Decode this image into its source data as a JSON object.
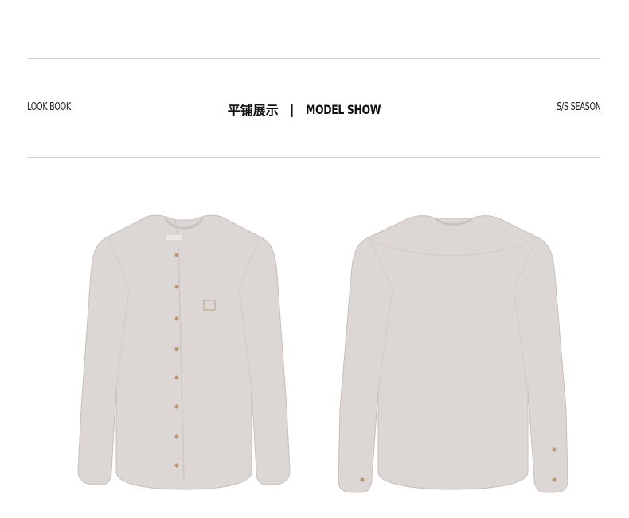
{
  "header": {
    "left_label": "LOOK BOOK",
    "title_cn": "平铺展示",
    "separator": "|",
    "title_en": "MODEL SHOW",
    "right_label": "S/S SEASON"
  },
  "products": [
    {
      "view": "front",
      "shirt_color": "#dcd6d4"
    },
    {
      "view": "back",
      "shirt_color": "#dcd6d4"
    }
  ],
  "colors": {
    "rule": "#cfcfcf",
    "shirt": "#dcd6d4",
    "button": "#b59772"
  }
}
